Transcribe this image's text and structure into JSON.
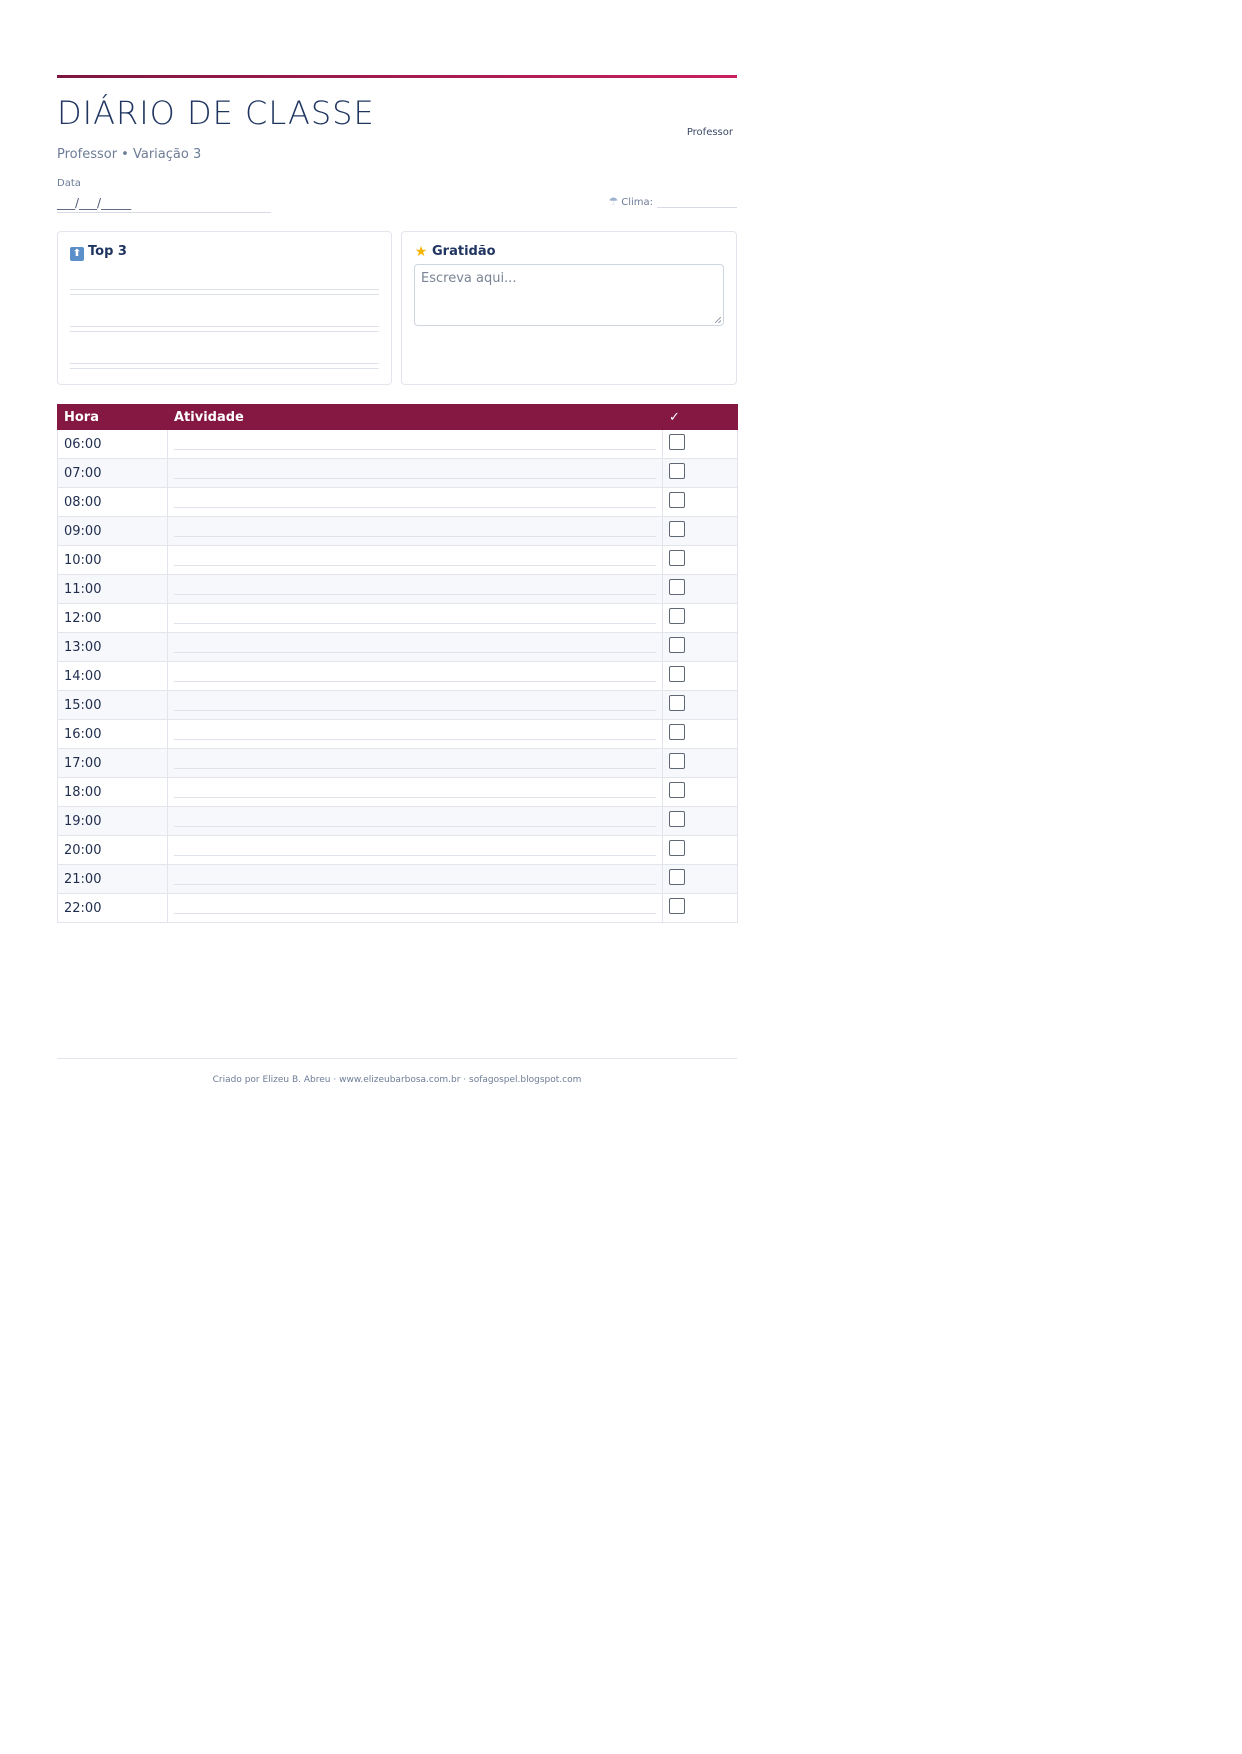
{
  "header": {
    "title": "DIÁRIO DE CLASSE",
    "badge": "Professor",
    "subtitle": "Professor • Variação 3",
    "date_label": "Data",
    "date_placeholder": "___/___/_____",
    "weather_label": "Clima:"
  },
  "top3": {
    "title": "Top 3",
    "icon": "up-arrow-emoji"
  },
  "gratitude": {
    "title": "Gratidão",
    "icon": "star-emoji",
    "placeholder": "Escreva aqui..."
  },
  "schedule": {
    "col_hour": "Hora",
    "col_activity": "Atividade",
    "col_check": "✓",
    "rows": [
      "06:00",
      "07:00",
      "08:00",
      "09:00",
      "10:00",
      "11:00",
      "12:00",
      "13:00",
      "14:00",
      "15:00",
      "16:00",
      "17:00",
      "18:00",
      "19:00",
      "20:00",
      "21:00",
      "22:00"
    ]
  },
  "footer": {
    "text": "Criado por Elizeu B. Abreu · www.elizeubarbosa.com.br · sofagospel.blogspot.com"
  },
  "colors": {
    "accent": "#851843",
    "title": "#1f3560"
  }
}
